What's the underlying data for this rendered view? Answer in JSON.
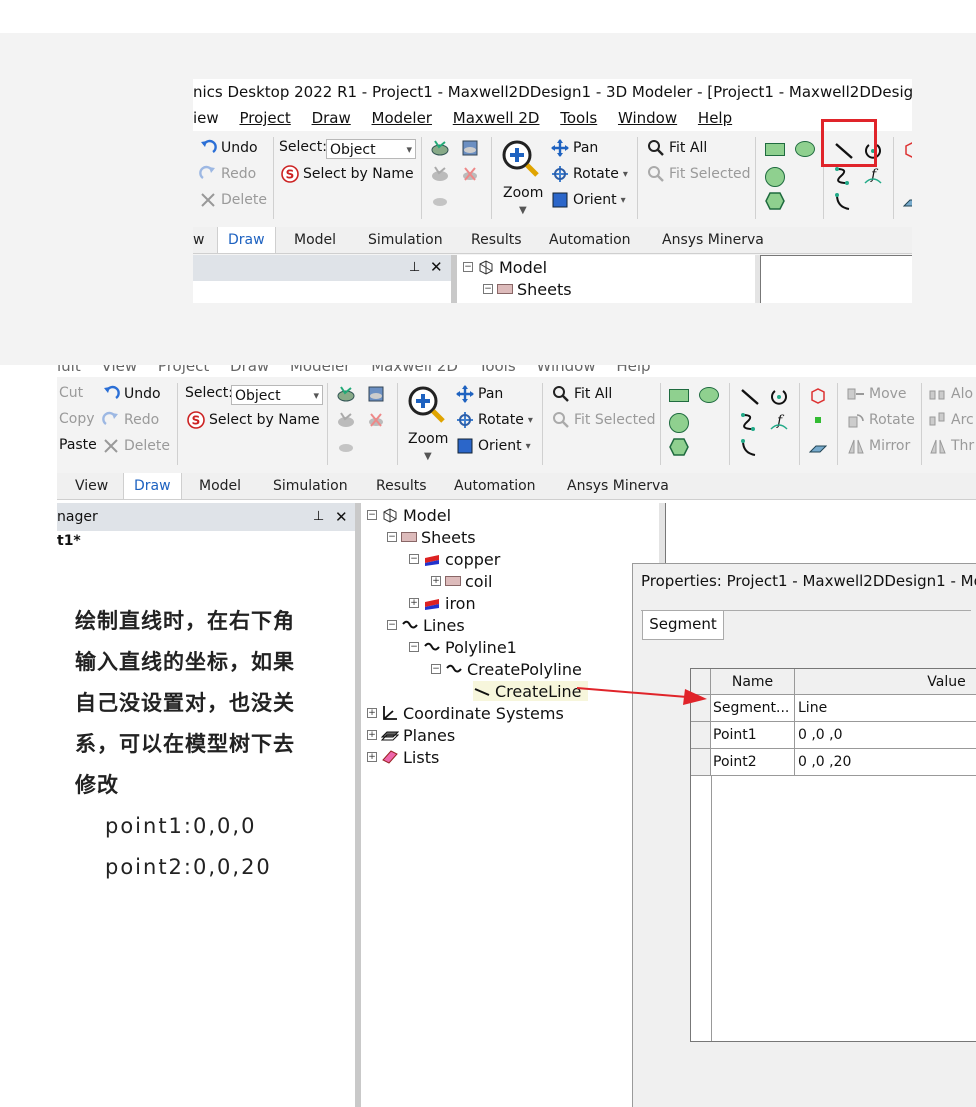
{
  "s1": {
    "title": "nics Desktop 2022 R1 - Project1 - Maxwell2DDesign1 - 3D Modeler - [Project1 - Maxwell2DDesign1",
    "menu": [
      "iew",
      "Project",
      "Draw",
      "Modeler",
      "Maxwell 2D",
      "Tools",
      "Window",
      "Help"
    ],
    "undo": "Undo",
    "redo": "Redo",
    "delete": "Delete",
    "select_label": "Select:",
    "select_value": "Object",
    "select_by_name": "Select by Name",
    "zoom": "Zoom",
    "pan": "Pan",
    "rotate": "Rotate",
    "orient": "Orient",
    "fit_all": "Fit All",
    "fit_selected": "Fit Selected",
    "tabs": [
      "w",
      "Draw",
      "Model",
      "Simulation",
      "Results",
      "Automation",
      "Ansys Minerva"
    ],
    "tree": {
      "model": "Model",
      "sheets": "Sheets"
    }
  },
  "s2": {
    "menu": [
      "ıult",
      "View",
      "Project",
      "Draw",
      "Modeler",
      "Maxwell 2D",
      "Tools",
      "Window",
      "Help"
    ],
    "cut": "Cut",
    "copy": "Copy",
    "paste": "Paste",
    "undo": "Undo",
    "redo": "Redo",
    "delete": "Delete",
    "select_label": "Select:",
    "select_value": "Object",
    "select_by_name": "Select by Name",
    "zoom": "Zoom",
    "pan": "Pan",
    "rotate": "Rotate",
    "orient": "Orient",
    "fit_all": "Fit All",
    "fit_selected": "Fit Selected",
    "move": "Move",
    "rotate2": "Rotate",
    "mirror": "Mirror",
    "right_cut": [
      "Alo",
      "Arc",
      "Thr"
    ],
    "tabs": [
      "View",
      "Draw",
      "Model",
      "Simulation",
      "Results",
      "Automation",
      "Ansys Minerva"
    ],
    "manager_title": "nager",
    "project_item": "t1*",
    "tree": {
      "model": "Model",
      "sheets": "Sheets",
      "copper": "copper",
      "coil": "coil",
      "iron": "iron",
      "lines": "Lines",
      "polyline1": "Polyline1",
      "create_polyline": "CreatePolyline",
      "create_line": "CreateLine",
      "coord": "Coordinate Systems",
      "planes": "Planes",
      "lists": "Lists"
    },
    "note": [
      "绘制直线时，在右下角",
      "输入直线的坐标，如果",
      "自己没设置对，也没关",
      "系，可以在模型树下去",
      "修改"
    ],
    "note_points": [
      "point1:0,0,0",
      "point2:0,0,20"
    ],
    "dialog": {
      "title": "Properties: Project1 - Maxwell2DDesign1 - Mo",
      "tab": "Segment",
      "col_name": "Name",
      "col_value": "Value",
      "rows": [
        {
          "name": "Segment...",
          "value": "Line"
        },
        {
          "name": "Point1",
          "value": "0 ,0 ,0"
        },
        {
          "name": "Point2",
          "value": "0 ,0 ,20"
        }
      ]
    }
  },
  "colors": {
    "accent": "#1e62c0",
    "highlight": "#e0242a"
  }
}
